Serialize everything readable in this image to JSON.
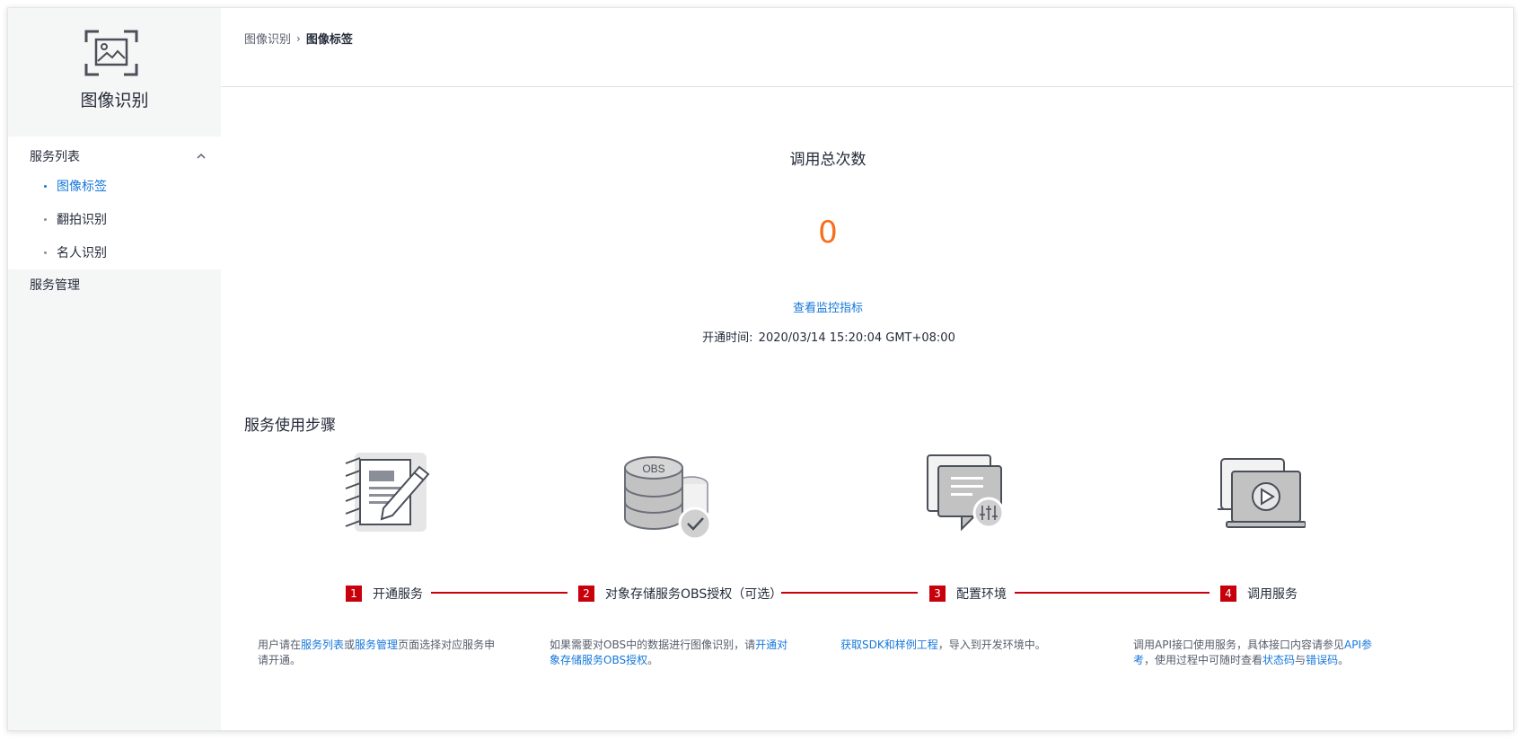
{
  "sidebar": {
    "brand_title": "图像识别",
    "group_label": "服务列表",
    "items": [
      {
        "label": "图像标签",
        "active": true
      },
      {
        "label": "翻拍识别",
        "active": false
      },
      {
        "label": "名人识别",
        "active": false
      }
    ],
    "mgmt_label": "服务管理"
  },
  "breadcrumb": {
    "parent": "图像识别",
    "separator": "›",
    "current": "图像标签"
  },
  "stats": {
    "title": "调用总次数",
    "value": "0",
    "link": "查看监控指标",
    "time_label": "开通时间:",
    "time_value": "2020/03/14 15:20:04 GMT+08:00"
  },
  "steps": {
    "title": "服务使用步骤",
    "items": [
      {
        "num": "1",
        "label": "开通服务"
      },
      {
        "num": "2",
        "label": "对象存储服务OBS授权（可选）"
      },
      {
        "num": "3",
        "label": "配置环境"
      },
      {
        "num": "4",
        "label": "调用服务"
      }
    ],
    "obs_text": "OBS",
    "desc1": {
      "t1": "用户请在",
      "l1": "服务列表",
      "t2": "或",
      "l2": "服务管理",
      "t3": "页面选择对应服务申请开通。"
    },
    "desc2": {
      "t1": "如果需要对OBS中的数据进行图像识别，请",
      "l1": "开通对象存储服务OBS授权",
      "t2": "。"
    },
    "desc3": {
      "l1": "获取SDK和样例工程",
      "t1": "，导入到开发环境中。"
    },
    "desc4": {
      "t1": "调用API接口使用服务，具体接口内容请参见",
      "l1": "API参考",
      "t2": "，使用过程中可随时查看",
      "l2": "状态码",
      "t3": "与",
      "l3": "错误码",
      "t4": "。"
    }
  },
  "colors": {
    "accent": "#1677d9",
    "value": "#f66f1c",
    "step_red": "#c7000b"
  }
}
